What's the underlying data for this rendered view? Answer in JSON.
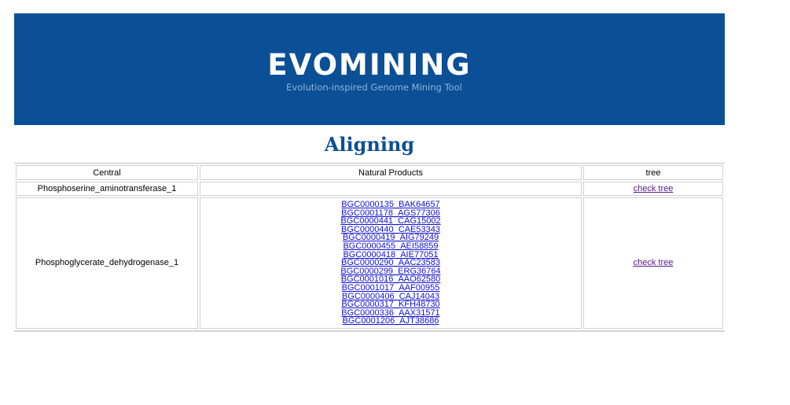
{
  "banner": {
    "title": "EVOMINING",
    "subtitle": "Evolution-inspired Genome Mining Tool",
    "background_color": "#0b4f96"
  },
  "page_title": "Aligning",
  "table": {
    "headers": [
      "Central",
      "Natural Products",
      "tree"
    ],
    "rows": [
      {
        "central": "Phosphoserine_aminotransferase_1",
        "natural_products": [],
        "tree_link": "check tree"
      },
      {
        "central": "Phosphoglycerate_dehydrogenase_1",
        "natural_products": [
          "BGC0000135_BAK64657",
          "BGC0001178_AGS77306",
          "BGC0000441_CAG15002",
          "BGC0000440_CAE53343",
          "BGC0000419_AIG79249",
          "BGC0000455_AEI58859",
          "BGC0000418_AIE77051",
          "BGC0000290_AAC23583",
          "BGC0000299_ERG36764",
          "BGC0001016_AAO62580",
          "BGC0001017_AAF00955",
          "BGC0000406_CAJ14043",
          "BGC0000317_KFH48730",
          "BGC0000336_AAX31571",
          "BGC0001206_AJT38686"
        ],
        "tree_link": "check tree"
      }
    ]
  }
}
